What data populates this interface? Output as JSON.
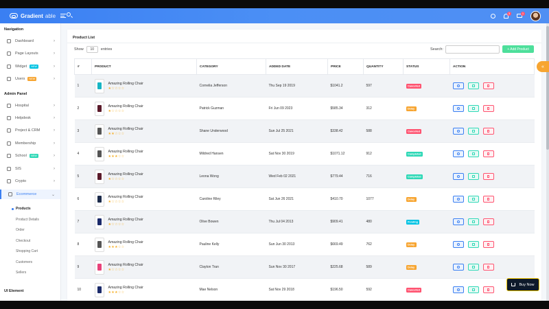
{
  "header": {
    "logo_text": "Gradient",
    "logo_sub": "able",
    "bell_badge": "3",
    "mail_badge": "1"
  },
  "sidebar": {
    "nav_caption": "Navigation",
    "admin_caption": "Admin Panel",
    "ui_caption": "UI Element",
    "nav_items": [
      {
        "label": "Dashboard",
        "chevron": true
      },
      {
        "label": "Page Layouts",
        "chevron": true
      },
      {
        "label": "Widget",
        "tag": "NEW",
        "tag_color": "#00c3e3",
        "chevron": true
      },
      {
        "label": "Users",
        "tag": "NEW",
        "tag_color": "#f7a531",
        "chevron": true
      }
    ],
    "admin_items": [
      {
        "label": "Hospital",
        "chevron": true
      },
      {
        "label": "Helpdesk",
        "chevron": true
      },
      {
        "label": "Project & CRM",
        "chevron": true
      },
      {
        "label": "Membership",
        "chevron": true
      },
      {
        "label": "School",
        "tag": "NEW",
        "tag_color": "#2ed8b6",
        "chevron": true
      },
      {
        "label": "SIS",
        "chevron": true
      },
      {
        "label": "Crypto",
        "chevron": true
      },
      {
        "label": "Ecommerce",
        "chevron": true
      }
    ],
    "ecommerce_sub": [
      "Products",
      "Product Details",
      "Order",
      "Checkout",
      "Shopping Cart",
      "Customers",
      "Sellers"
    ],
    "active_sub": "Products"
  },
  "card": {
    "title": "Product List",
    "show_label": "Show",
    "entries_value": "10",
    "entries_label": "entries",
    "search_label": "Search:",
    "add_button": "+ Add Product"
  },
  "table": {
    "headers": [
      "#",
      "PRODUCT",
      "CATEGORY",
      "ADDED DATE",
      "PRICE",
      "QUANTITY",
      "STATUS",
      "ACTION"
    ],
    "rows": [
      {
        "num": "1",
        "name": "Amazing Rolling Chair",
        "rating": 1,
        "thumb_color": "#17b5c4",
        "category": "Cornelia Jefferson",
        "date": "Thu Sep 19 2019",
        "price": "$1041.2",
        "qty": "597",
        "status": "Cancelled"
      },
      {
        "num": "2",
        "name": "Amazing Rolling Chair",
        "rating": 1,
        "thumb_color": "#5a1a2a",
        "category": "Patrick Guzman",
        "date": "Fri Jun 09 2023",
        "price": "$585.34",
        "qty": "312",
        "status": "Delay"
      },
      {
        "num": "3",
        "name": "Amazing Rolling Chair",
        "rating": 2,
        "thumb_color": "#555555",
        "category": "Shane Underwood",
        "date": "Sun Jul 25 2021",
        "price": "$338.42",
        "qty": "588",
        "status": "Cancelled"
      },
      {
        "num": "4",
        "name": "Amazing Rolling Chair",
        "rating": 3,
        "thumb_color": "#555555",
        "category": "Mildred Hansen",
        "date": "Sat Nov 30 2019",
        "price": "$1071.12",
        "qty": "912",
        "status": "Completed"
      },
      {
        "num": "5",
        "name": "Amazing Rolling Chair",
        "rating": 1,
        "thumb_color": "#5a1a2a",
        "category": "Leona Wong",
        "date": "Wed Feb 02 2021",
        "price": "$779.44",
        "qty": "716",
        "status": "Completed"
      },
      {
        "num": "6",
        "name": "Amazing Rolling Chair",
        "rating": 1,
        "thumb_color": "#1b2a4a",
        "category": "Caroline Riley",
        "date": "Sat Jun 26 2021",
        "price": "$410.70",
        "qty": "1077",
        "status": "Delay"
      },
      {
        "num": "7",
        "name": "Amazing Rolling Chair",
        "rating": 1,
        "thumb_color": "#1b2a6a",
        "category": "Olive Bowen",
        "date": "Thu Jul 04 2013",
        "price": "$909.41",
        "qty": "480",
        "status": "Pending"
      },
      {
        "num": "8",
        "name": "Amazing Rolling Chair",
        "rating": 3,
        "thumb_color": "#555555",
        "category": "Pauline Kelly",
        "date": "Sun Jun 30 2013",
        "price": "$669.49",
        "qty": "762",
        "status": "Delay"
      },
      {
        "num": "9",
        "name": "Amazing Rolling Chair",
        "rating": 1,
        "thumb_color": "#e8427a",
        "category": "Clayton Tran",
        "date": "Sun Nov 30 2017",
        "price": "$225.68",
        "qty": "589",
        "status": "Delay"
      },
      {
        "num": "10",
        "name": "Amazing Rolling Chair",
        "rating": 3,
        "thumb_color": "#1b2a6a",
        "category": "Mae Nelson",
        "date": "Sat Nov 29 2018",
        "price": "$196.50",
        "qty": "592",
        "status": "Cancelled"
      }
    ]
  },
  "status_colors": {
    "Cancelled": "#ff5370",
    "Delay": "#f7a531",
    "Completed": "#2ed8b6",
    "Pending": "#00c3e3"
  },
  "buy_now": "Buy Now",
  "icons": [
    "search-icon",
    "menu-icon",
    "settings-icon",
    "bell-icon",
    "mail-icon",
    "eye-icon",
    "edit-icon",
    "trash-icon",
    "cart-icon"
  ]
}
